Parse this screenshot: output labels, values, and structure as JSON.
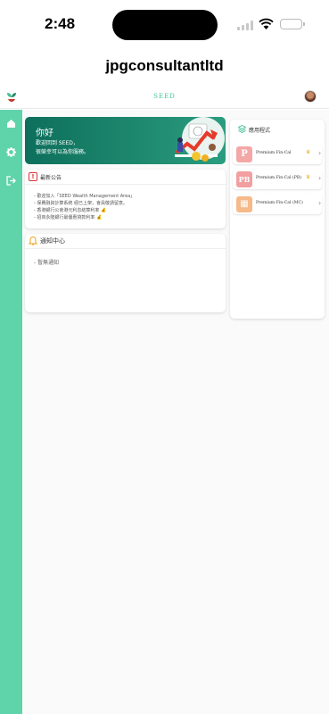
{
  "status": {
    "time": "2:48"
  },
  "app_title": "jpgconsultantltd",
  "header": {
    "brand": "SEED"
  },
  "welcome": {
    "title": "你好",
    "line1": "歡迎回到 SEED，",
    "line2": "很榮幸可以為你服務。"
  },
  "announcements": {
    "title": "最新公告",
    "items": [
      "- 歡迎加入「SEED Wealth Management Area」",
      "- 保費融資計算系統 經已上架，會員敬請留意。",
      "- 香港銀行公會港元利息結算利率",
      "- 招商永隆銀行最優惠貸款利率"
    ]
  },
  "notifications": {
    "title": "通知中心",
    "empty_text": "- 暫無通知"
  },
  "apps": {
    "title": "應用程式",
    "items": [
      {
        "badge": "P",
        "name": "Premium Fin-Cal",
        "color": "#f4a7a7"
      },
      {
        "badge": "PB",
        "name": "Premium Fin-Cal (PB)",
        "color": "#f29f9f"
      },
      {
        "badge": "▦",
        "name": "Premium Fin-Cal (MC)",
        "color": "#f6b98a"
      }
    ]
  },
  "colors": {
    "accent": "#5fd3aa",
    "brand_text": "#41c49a",
    "welcome_bg": "#0d6f5c"
  }
}
